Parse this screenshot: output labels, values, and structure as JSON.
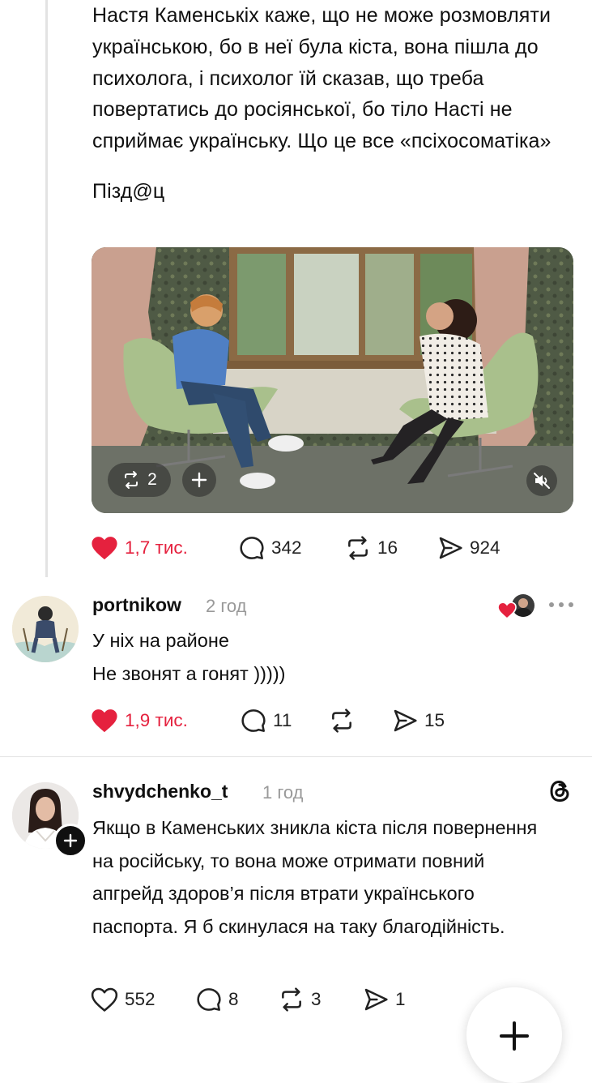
{
  "post": {
    "text_p1": "Настя Каменськіх каже, що не може розмовляти українською, бо в неї була кіста, вона пішла до психолога, і психолог їй сказав, що треба повертатись до росіянської, бо тіло Насті не сприймає українську. Що це все «псіхосоматіка»",
    "text_p2": "Пізд@ц",
    "media": {
      "repost_count": "2"
    },
    "likes": "1,7 тис.",
    "comments": "342",
    "reposts": "16",
    "shares": "924"
  },
  "reply1": {
    "username": "portnikow",
    "time": "2 год",
    "line1": "У ніх на районе",
    "line2": "Не звонят а гонят )))))",
    "likes": "1,9 тис.",
    "comments": "11",
    "shares": "15"
  },
  "reply2": {
    "username": "shvydchenko_t",
    "time": "1 год",
    "text": "Якщо в Каменських зникла кіста після повернення на російську, то вона може отримати повний апгрейд здоров’я після втрати українського паспорта. Я б скинулася на таку благодійність.",
    "likes": "552",
    "comments": "8",
    "reposts": "3",
    "shares": "1"
  },
  "colors": {
    "like_red": "#e5213e",
    "muted": "#999999",
    "divider": "#e3e3e3"
  },
  "icons": [
    "heart-icon",
    "comment-icon",
    "repost-icon",
    "share-icon",
    "plus-icon",
    "mute-icon",
    "more-icon",
    "threads-logo-icon"
  ]
}
